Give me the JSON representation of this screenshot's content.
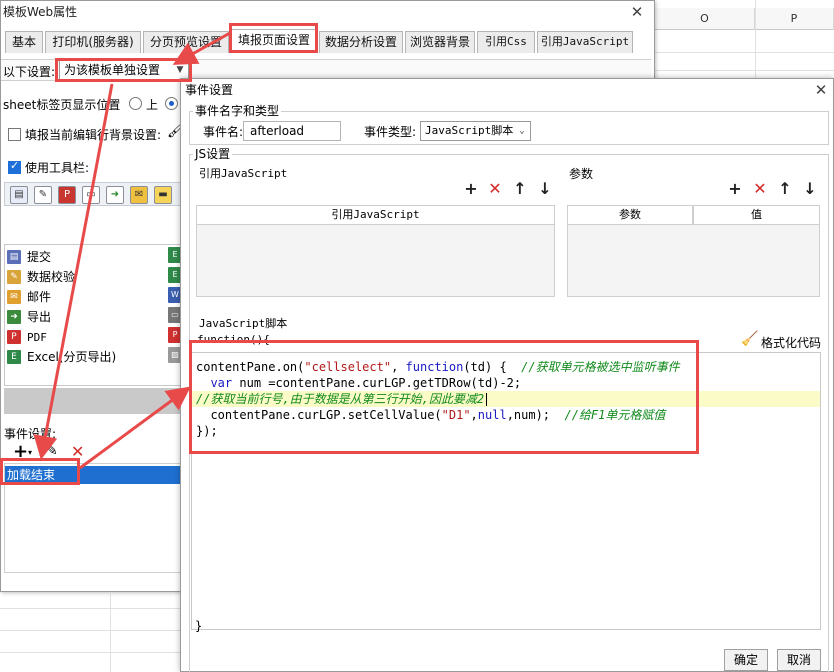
{
  "sheet": {
    "col_headers": [
      "O",
      "P"
    ]
  },
  "main_dialog": {
    "title": "模板Web属性",
    "close_icon": "close-icon",
    "tabs": [
      {
        "label": "基本"
      },
      {
        "label": "打印机(服务器)"
      },
      {
        "label": "分页预览设置"
      },
      {
        "label": "填报页面设置"
      },
      {
        "label": "数据分析设置"
      },
      {
        "label": "浏览器背景"
      },
      {
        "label": "引用Css"
      },
      {
        "label": "引用JavaScript"
      }
    ],
    "active_tab": "填报页面设置",
    "setting_label": "以下设置:",
    "setting_value": "为该模板单独设置",
    "sheet_tab_label": "sheet标签页显示位置",
    "radio_top_label": "上",
    "fill_bg_label": "填报当前编辑行背景设置:",
    "use_toolbar_label": "使用工具栏:",
    "toolbar_items": [
      {
        "label": "提交",
        "icon": "save-icon"
      },
      {
        "label": "数据校验",
        "icon": "pencil-icon"
      },
      {
        "label": "邮件",
        "icon": "mail-icon"
      },
      {
        "label": "导出",
        "icon": "export-icon"
      },
      {
        "label": "PDF",
        "icon": "pdf-icon"
      },
      {
        "label": "Excel(分页导出)",
        "icon": "excel-icon"
      }
    ],
    "event_settings_label": "事件设置:",
    "events": [
      {
        "label": "加载结束"
      }
    ]
  },
  "event_dialog": {
    "title": "事件设置",
    "name_type_group": "事件名字和类型",
    "event_name_label": "事件名:",
    "event_name_value": "afterload",
    "event_type_label": "事件类型:",
    "event_type_value": "JavaScript脚本",
    "js_group": "JS设置",
    "ref_js_label": "引用JavaScript",
    "ref_js_header": "引用JavaScript",
    "params_label": "参数",
    "params_header_name": "参数",
    "params_header_value": "值",
    "script_label": "JavaScript脚本",
    "function_open": "function(){",
    "format_label": "格式化代码",
    "closing_brace": "}",
    "code_lines": [
      "contentPane.on(\"cellselect\", function(td) {  //获取单元格被选中监听事件",
      "  var num =contentPane.curLGP.getTDRow(td)-2;",
      "//获取当前行号,由于数据是从第三行开始,因此要减2",
      "  contentPane.curLGP.setCellValue(\"D1\",null,num);  //给F1单元格赋值",
      "});"
    ],
    "highlighted_line": 2,
    "ok_label": "确定",
    "cancel_label": "取消"
  },
  "annotation_color": "#e84a4a"
}
